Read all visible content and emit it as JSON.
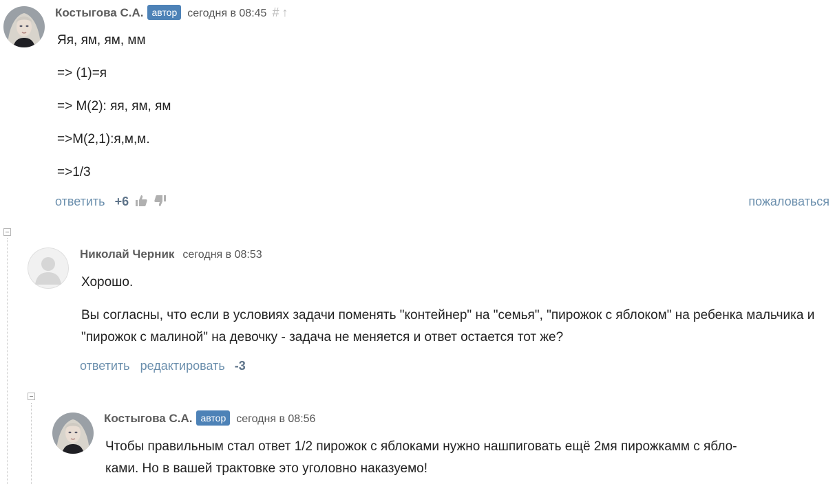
{
  "comments": [
    {
      "author": "Костыгова С.А.",
      "badge": "автор",
      "time": "сегодня в 08:45",
      "hash": "#",
      "up": "↑",
      "lines": [
        "Яя, ям, ям, мм",
        "=> (1)=я",
        "=> М(2): яя, ям, ям",
        "=>М(2,1):я,м,м.",
        "=>1/3"
      ],
      "reply": "ответить",
      "score": "+6",
      "complain": "пожаловаться",
      "avatar_icon": "woman-portrait-avatar"
    },
    {
      "author": "Николай Черник",
      "time": "сегодня в 08:53",
      "lines": [
        "Хорошо.",
        "Вы согласны, что если в условиях задачи поменять \"контейнер\" на \"семья\", \"пирожок с яблоком\" на ребенка мальчика и \"пирожок с малиной\" на девочку - задача не меняется и ответ остается тот же?"
      ],
      "reply": "ответить",
      "edit": "редактировать",
      "score": "-3",
      "avatar_icon": "default-user-avatar"
    },
    {
      "author": "Костыгова С.А.",
      "badge": "автор",
      "time": "сегодня в 08:56",
      "lines": [
        "Чтобы правильным стал ответ 1/2 пирожок с яблоками нужно нашпиговать ещё 2мя пирожкамм с ябло-",
        "ками. Но в вашей трактовке это уголовно наказуемо!"
      ],
      "avatar_icon": "woman-portrait-avatar"
    }
  ],
  "colors": {
    "link": "#6b8fad",
    "badge": "#4d82b7",
    "score": "#5d7389",
    "author": "#5c5c5c"
  },
  "icons": {
    "like": "thumbs-up-icon",
    "dislike": "thumbs-down-icon",
    "collapse": "collapse-minus-icon"
  }
}
